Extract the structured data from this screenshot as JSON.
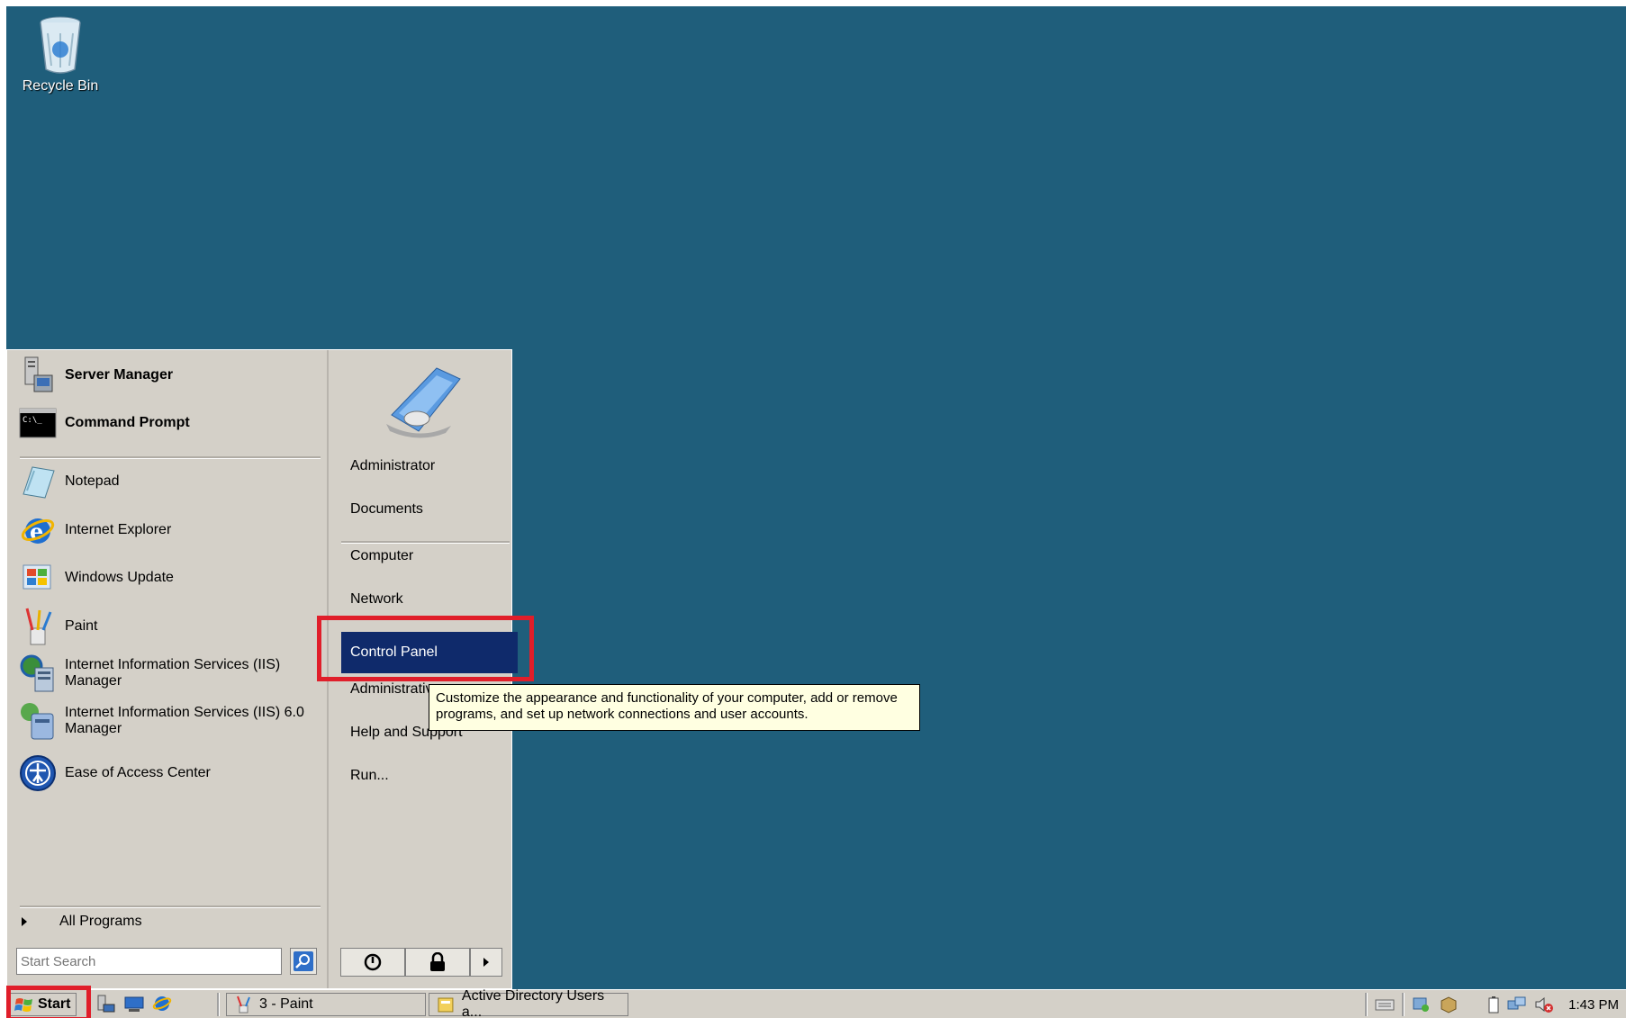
{
  "desktop": {
    "recycle_bin_label": "Recycle Bin",
    "background_color": "#1f5e7b"
  },
  "start_menu": {
    "pinned": [
      {
        "label": "Server Manager",
        "icon": "server-manager-icon"
      },
      {
        "label": "Command Prompt",
        "icon": "command-prompt-icon"
      }
    ],
    "programs": [
      {
        "label": "Notepad",
        "icon": "notepad-icon"
      },
      {
        "label": "Internet Explorer",
        "icon": "internet-explorer-icon"
      },
      {
        "label": "Windows Update",
        "icon": "windows-update-icon"
      },
      {
        "label": "Paint",
        "icon": "paint-icon"
      },
      {
        "label": "Internet Information Services (IIS) Manager",
        "line1": "Internet Information Services (IIS)",
        "line2": "Manager",
        "icon": "iis-icon"
      },
      {
        "label": "Internet Information Services (IIS) 6.0 Manager",
        "line1": "Internet Information Services (IIS) 6.0",
        "line2": "Manager",
        "icon": "iis6-icon"
      },
      {
        "label": "Ease of Access Center",
        "icon": "ease-of-access-icon"
      }
    ],
    "all_programs_label": "All Programs",
    "search_placeholder": "Start Search",
    "right_items": {
      "administrator": "Administrator",
      "documents": "Documents",
      "computer": "Computer",
      "network": "Network",
      "control_panel": "Control Panel",
      "administrative": "Administrativ",
      "help": "Help and Support",
      "run": "Run..."
    },
    "tooltip": {
      "line1": "Customize the appearance and functionality of your computer, add or remove",
      "line2": "programs, and set up network connections and user accounts."
    },
    "highlight_color": "#0f2a6b",
    "callout_color": "#e01e2a"
  },
  "taskbar": {
    "start_label": "Start",
    "tasks": [
      {
        "label": "3 - Paint",
        "icon": "paint-icon"
      },
      {
        "label": "Active Directory Users a...",
        "icon": "folder-icon"
      }
    ],
    "clock": "1:43 PM"
  }
}
